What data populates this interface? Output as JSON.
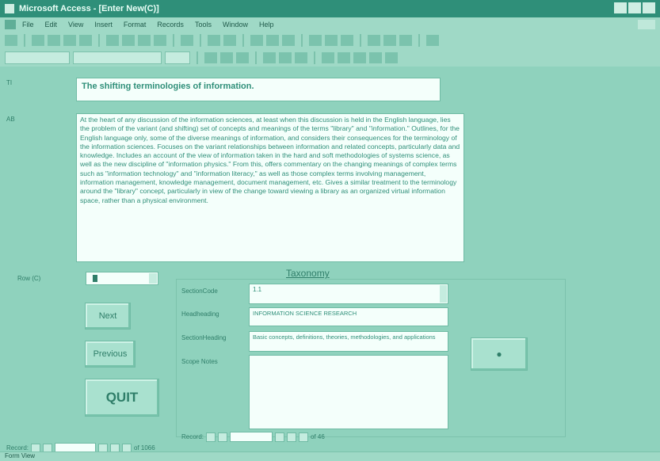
{
  "window": {
    "title": "Microsoft Access - [Enter New(C)]"
  },
  "menu": [
    "File",
    "Edit",
    "View",
    "Insert",
    "Format",
    "Records",
    "Tools",
    "Window",
    "Help"
  ],
  "fields": {
    "ti_label": "TI",
    "ab_label": "AB",
    "title_value": "The shifting terminologies of information.",
    "abstract_value": "At the heart of any discussion of the information sciences, at least when this discussion is held in the English language, lies the problem of the variant (and shifting) set of concepts and meanings of the terms \"library\" and \"information.\" Outlines, for the English language only, some of the diverse meanings of information, and considers their consequences for the terminology of the information sciences. Focuses on the variant relationships between information and related concepts, particularly data and knowledge. Includes an account of the view of information taken in the hard and soft methodologies of systems science, as well as the new discipline of \"information physics.\" From this, offers commentary on the changing meanings of complex terms such as \"information technology\" and \"information literacy,\" as well as those complex terms involving management, information management, knowledge management, document management, etc. Gives a similar treatment to the terminology around the \"library\" concept, particularly in view of the change toward viewing a library as an organized virtual information space, rather than a physical environment.",
    "row_label": "Row (C)"
  },
  "buttons": {
    "next": "Next",
    "previous": "Previous",
    "quit": "QUIT"
  },
  "taxonomy": {
    "heading": "Taxonomy",
    "section_code_label": "SectionCode",
    "section_code_value": "1.1",
    "head_label": "Headheading",
    "head_value": "INFORMATION SCIENCE RESEARCH",
    "section_heading_label": "SectionHeading",
    "section_heading_value": "Basic concepts, definitions, theories, methodologies, and applications",
    "scope_label": "Scope Notes"
  },
  "nav": {
    "record_label": "Record:",
    "of_text": "of 1066",
    "inner_of_text": "of 46"
  },
  "status": {
    "text": "Form View"
  }
}
